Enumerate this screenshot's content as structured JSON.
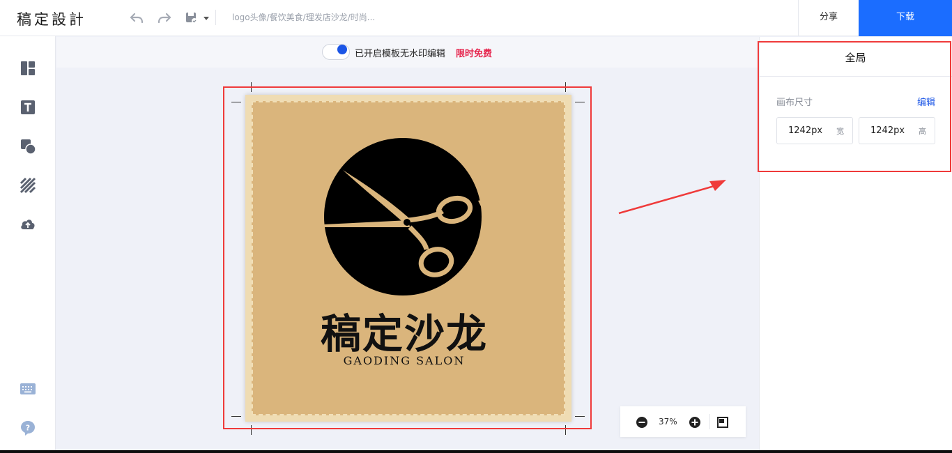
{
  "app": {
    "logo": "稿定設計",
    "doc_title": "logo头像/餐饮美食/理发店沙龙/时尚..."
  },
  "toolbar": {
    "undo_icon": "undo-icon",
    "redo_icon": "redo-icon",
    "save_icon": "save-icon"
  },
  "header": {
    "share_label": "分享",
    "download_label": "下载"
  },
  "sidebar": {
    "items": [
      {
        "icon": "template-icon"
      },
      {
        "icon": "text-icon"
      },
      {
        "icon": "shapes-icon"
      },
      {
        "icon": "background-icon"
      },
      {
        "icon": "upload-icon"
      },
      {
        "icon": "keyboard-icon"
      },
      {
        "icon": "help-icon"
      }
    ]
  },
  "watermark": {
    "text": "已开启模板无水印编辑",
    "free_text": "限时免费",
    "enabled": true
  },
  "canvas": {
    "cn_name": "稿定沙龙",
    "en_name": "GAODING SALON"
  },
  "zoom": {
    "value": "37%"
  },
  "panel": {
    "title": "全局",
    "canvas_size_label": "画布尺寸",
    "edit_label": "编辑",
    "width_value": "1242px",
    "width_unit": "宽",
    "height_value": "1242px",
    "height_unit": "高"
  },
  "colors": {
    "accent": "#1b6dff",
    "canvas_bg": "#dab57c",
    "highlight": "#ef3a3a",
    "free_red": "#e6264e"
  }
}
